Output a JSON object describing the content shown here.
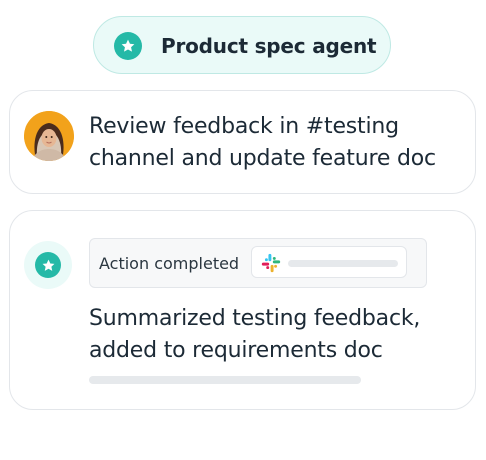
{
  "agent": {
    "title": "Product spec agent",
    "accent_color": "#25b9a7",
    "icon": "star-icon"
  },
  "request": {
    "avatar_icon": "user-avatar",
    "text_line1": "Review feedback in #testing",
    "text_line2": "channel and update feature doc"
  },
  "result": {
    "badge_icon": "star-icon",
    "status_label": "Action completed",
    "app_icon": "slack-icon",
    "summary_line1": "Summarized testing feedback,",
    "summary_line2": "added to requirements doc"
  }
}
